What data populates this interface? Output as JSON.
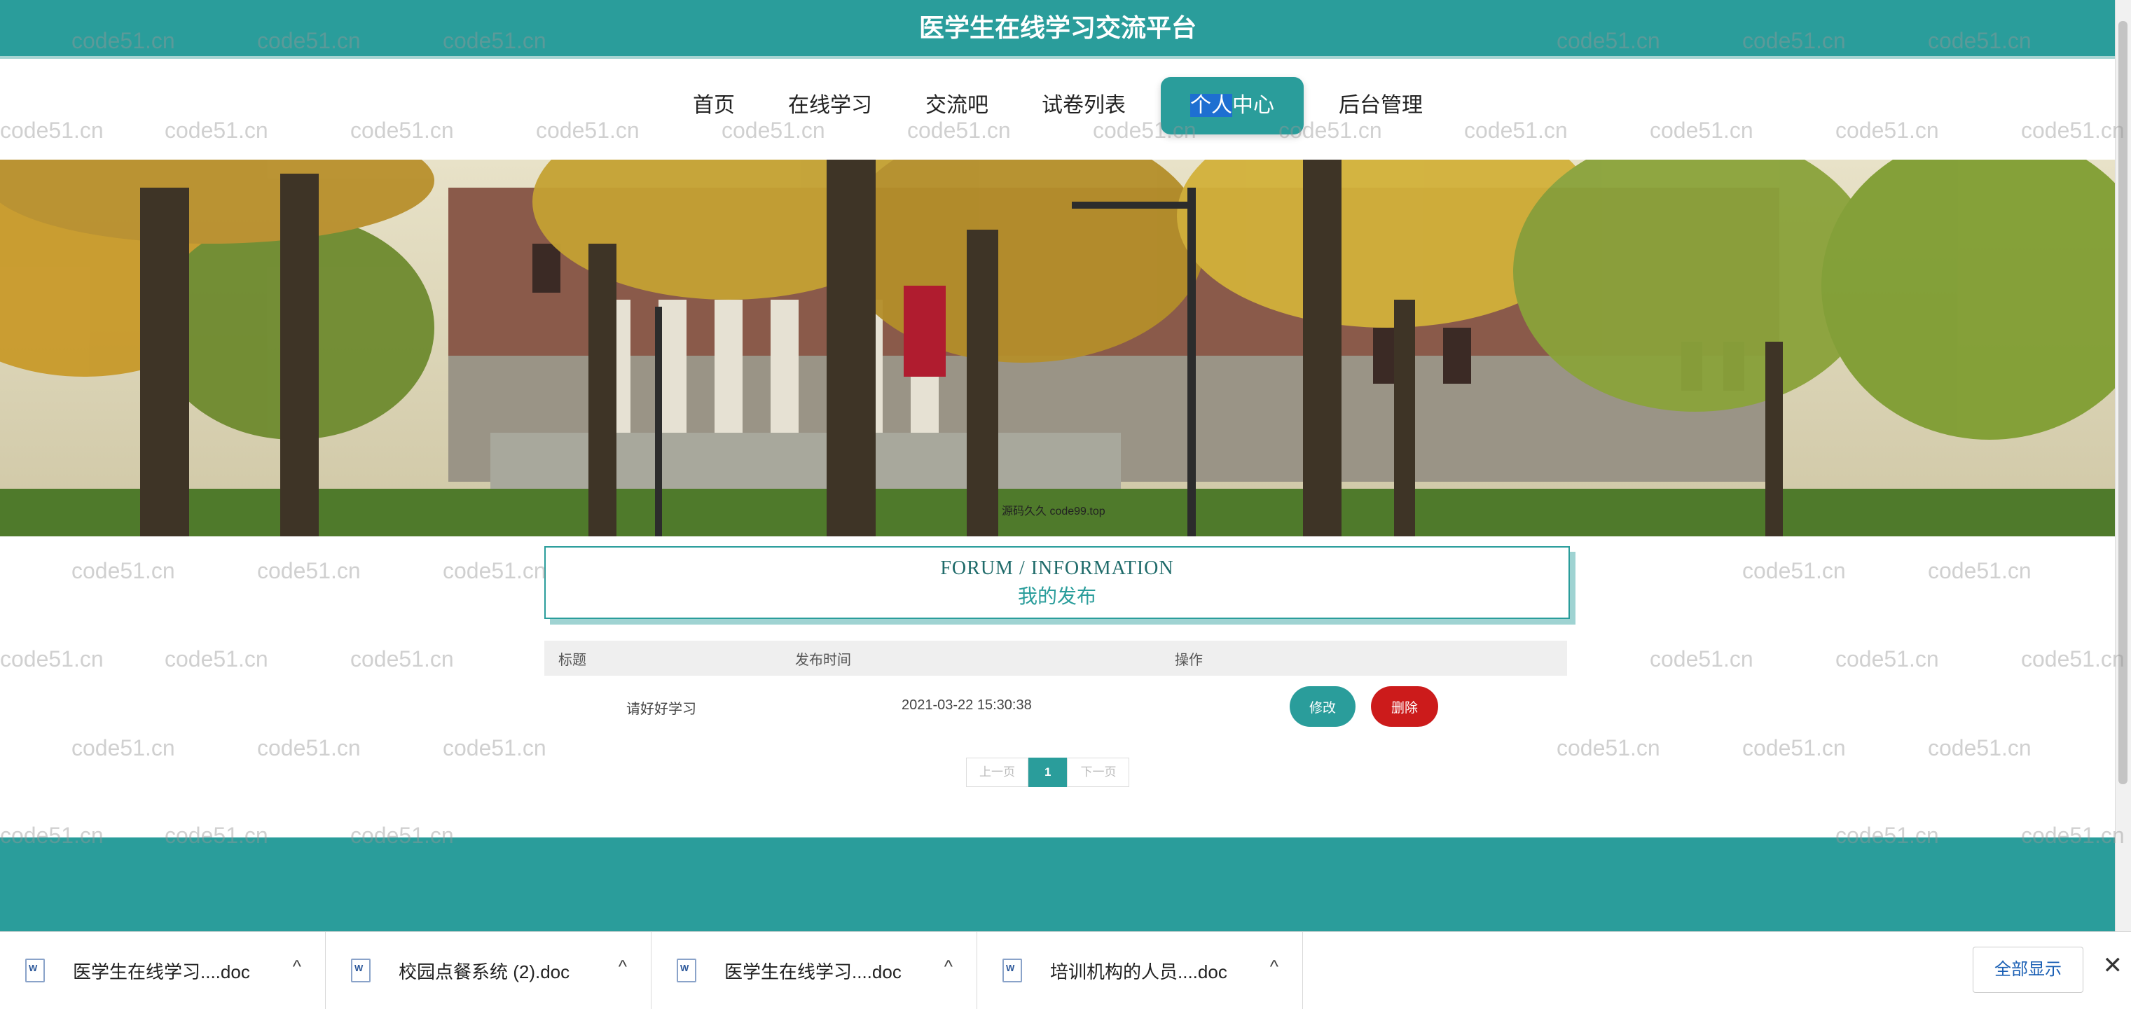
{
  "site": {
    "title": "医学生在线学习交流平台"
  },
  "nav": {
    "items": [
      "首页",
      "在线学习",
      "交流吧",
      "试卷列表",
      "个人中心",
      "后台管理"
    ],
    "active_part1": "个人",
    "active_part2": "中心"
  },
  "banner": {
    "overlay_text": "源码久久 code99.top"
  },
  "section": {
    "title_en": "FORUM / INFORMATION",
    "title_cn": "我的发布"
  },
  "table": {
    "headers": [
      "标题",
      "发布时间",
      "操作"
    ],
    "rows": [
      {
        "title": "请好好学习",
        "time": "2021-03-22 15:30:38",
        "edit": "修改",
        "delete": "删除"
      }
    ]
  },
  "pager": {
    "prev": "上一页",
    "current": "1",
    "next": "下一页"
  },
  "downloads": {
    "items": [
      {
        "name": "医学生在线学习....doc"
      },
      {
        "name": "校园点餐系统 (2).doc"
      },
      {
        "name": "医学生在线学习....doc"
      },
      {
        "name": "培训机构的人员....doc"
      }
    ],
    "show_all": "全部显示",
    "close_glyph": "✕",
    "chevron": "^"
  },
  "watermark": "code51.cn",
  "colors": {
    "primary": "#2a9d9b",
    "danger": "#cc1b1b"
  }
}
